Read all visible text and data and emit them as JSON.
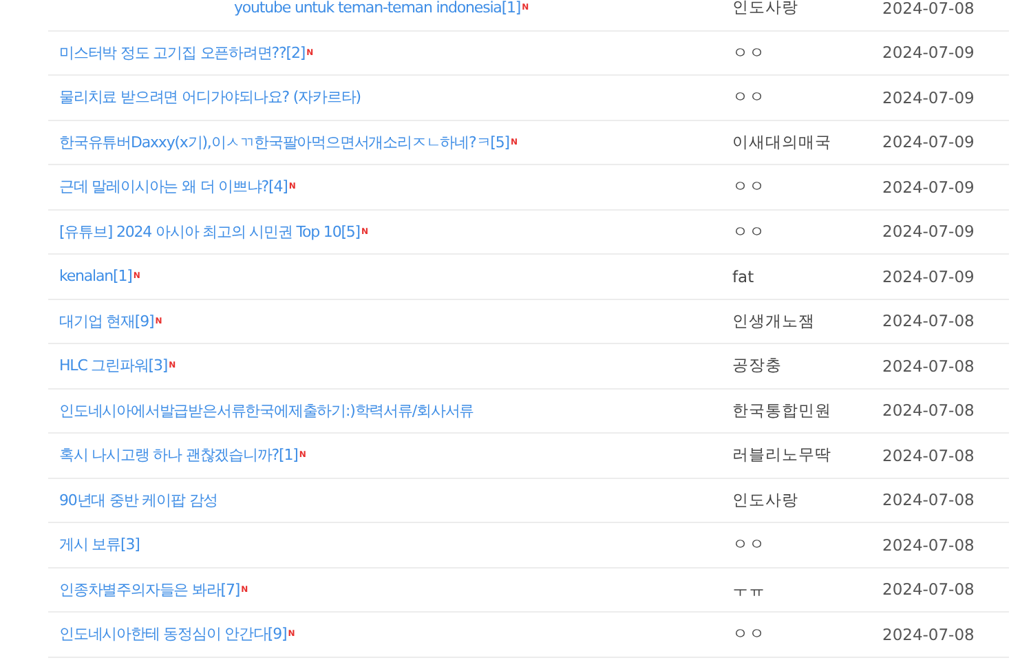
{
  "posts": [
    {
      "kind": "reply",
      "title": "youtube untuk teman-teman indonesia[1]",
      "badge": "N",
      "author": "인도사랑",
      "date": "2024-07-08"
    },
    {
      "kind": "post",
      "title": "미스터박 정도 고기집 오픈하려면??[2]",
      "badge": "N",
      "author": "ㅇㅇ",
      "date": "2024-07-09"
    },
    {
      "kind": "post",
      "title": "물리치료 받으려면 어디가야되나요? (자카르타)",
      "author": "ㅇㅇ",
      "date": "2024-07-09"
    },
    {
      "kind": "post",
      "title": "한국유튜버Daxxy(x기),이ㅅㄲ한국팔아먹으면서개소리ㅈㄴ하네?ㅋ[5]",
      "badge": "N",
      "author": "이새대의매국",
      "date": "2024-07-09"
    },
    {
      "kind": "post",
      "title": "근데 말레이시아는 왜 더 이쁘냐?[4]",
      "badge": "N",
      "author": "ㅇㅇ",
      "date": "2024-07-09"
    },
    {
      "kind": "post",
      "title": "[유튜브] 2024 아시아 최고의 시민권 Top 10[5]",
      "badge": "N",
      "author": "ㅇㅇ",
      "date": "2024-07-09"
    },
    {
      "kind": "post",
      "title": "kenalan[1]",
      "badge": "N",
      "author": "fat",
      "date": "2024-07-09"
    },
    {
      "kind": "post",
      "title": "대기업 현재[9]",
      "badge": "N",
      "author": "인생개노잼",
      "date": "2024-07-08"
    },
    {
      "kind": "post",
      "title": "HLC 그린파워[3]",
      "badge": "N",
      "author": "공장충",
      "date": "2024-07-08"
    },
    {
      "kind": "post",
      "title": "인도네시아에서발급받은서류한국에제출하기:)학력서류/회사서류",
      "author": "한국통합민원",
      "date": "2024-07-08"
    },
    {
      "kind": "post",
      "title": "혹시 나시고랭 하나 괜찮겠습니까?[1]",
      "badge": "N",
      "author": "러블리노무딱",
      "date": "2024-07-08"
    },
    {
      "kind": "post",
      "title": "90년대 중반 케이팝 감성",
      "author": "인도사랑",
      "date": "2024-07-08"
    },
    {
      "kind": "post",
      "title": "게시 보류[3]",
      "author": "ㅇㅇ",
      "date": "2024-07-08"
    },
    {
      "kind": "post",
      "title": "인종차별주의자들은 봐라[7]",
      "badge": "N",
      "author": "ㅜㅠ",
      "date": "2024-07-08"
    },
    {
      "kind": "post",
      "title": "인도네시아한테 동정심이 안간다[9]",
      "badge": "N",
      "author": "ㅇㅇ",
      "date": "2024-07-08"
    }
  ]
}
